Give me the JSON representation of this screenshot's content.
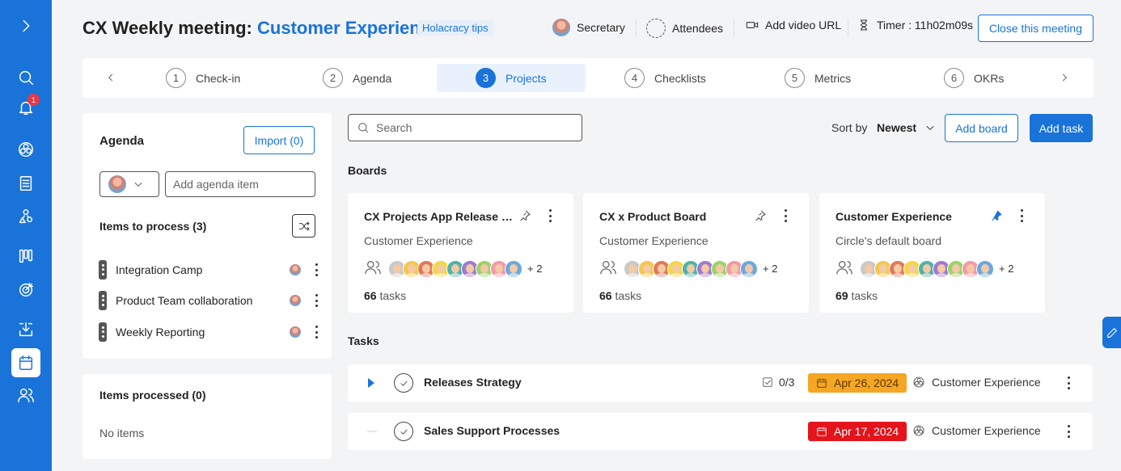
{
  "sidebar": {
    "items": [
      {
        "name": "expand-icon"
      },
      {
        "name": "search-icon"
      },
      {
        "name": "bell-icon",
        "badge": "1"
      },
      {
        "name": "circles-icon"
      },
      {
        "name": "document-icon"
      },
      {
        "name": "roles-icon"
      },
      {
        "name": "board-icon"
      },
      {
        "name": "target-icon"
      },
      {
        "name": "inbox-icon"
      },
      {
        "name": "calendar-icon",
        "active": true
      },
      {
        "name": "people-icon"
      }
    ]
  },
  "header": {
    "title_prefix": "CX Weekly meeting: ",
    "title_circle": "Customer Experience",
    "tips": "Holacracy tips",
    "secretary": "Secretary",
    "attendees": "Attendees",
    "video": "Add video URL",
    "timer": "Timer : 11h02m09s",
    "close": "Close this meeting"
  },
  "steps": [
    {
      "num": "1",
      "label": "Check-in"
    },
    {
      "num": "2",
      "label": "Agenda"
    },
    {
      "num": "3",
      "label": "Projects",
      "active": true
    },
    {
      "num": "4",
      "label": "Checklists"
    },
    {
      "num": "5",
      "label": "Metrics"
    },
    {
      "num": "6",
      "label": "OKRs"
    }
  ],
  "agenda": {
    "title": "Agenda",
    "import": "Import (0)",
    "input_placeholder": "Add agenda item",
    "to_process": "Items to process (3)",
    "items": [
      "Integration Camp",
      "Product Team collaboration",
      "Weekly Reporting"
    ],
    "processed_title": "Items processed (0)",
    "no_items": "No items"
  },
  "toolbar": {
    "search_placeholder": "Search",
    "sort_label": "Sort by",
    "sort_value": "Newest",
    "add_board": "Add board",
    "add_task": "Add task"
  },
  "boards_label": "Boards",
  "boards": [
    {
      "name": "CX Projects App Release Board",
      "circle": "Customer Experience",
      "more": "+ 2",
      "count": "66",
      "count_label": " tasks",
      "pinned": false
    },
    {
      "name": "CX x Product Board",
      "circle": "Customer Experience",
      "more": "+ 2",
      "count": "66",
      "count_label": " tasks",
      "pinned": false
    },
    {
      "name": "Customer Experience",
      "circle": "Circle's default board",
      "more": "+ 2",
      "count": "69",
      "count_label": " tasks",
      "pinned": true
    }
  ],
  "member_colors": [
    "#c9c9c9",
    "#f5c84c",
    "#e07b5a",
    "#f5d742",
    "#4fb3a9",
    "#a07bd0",
    "#9bd36a",
    "#f29aa6",
    "#6aa9e0"
  ],
  "tasks_label": "Tasks",
  "tasks": [
    {
      "name": "Releases Strategy",
      "subtasks": "0/3",
      "due": "Apr 26, 2024",
      "due_status": "upcoming",
      "circle": "Customer Experience"
    },
    {
      "name": "Sales Support Processes",
      "subtasks": "",
      "due": "Apr 17, 2024",
      "due_status": "overdue",
      "circle": "Customer Experience"
    }
  ],
  "colors": {
    "accent": "#1a73d9",
    "due_upcoming": "#f5a623",
    "due_overdue": "#e3141b"
  }
}
